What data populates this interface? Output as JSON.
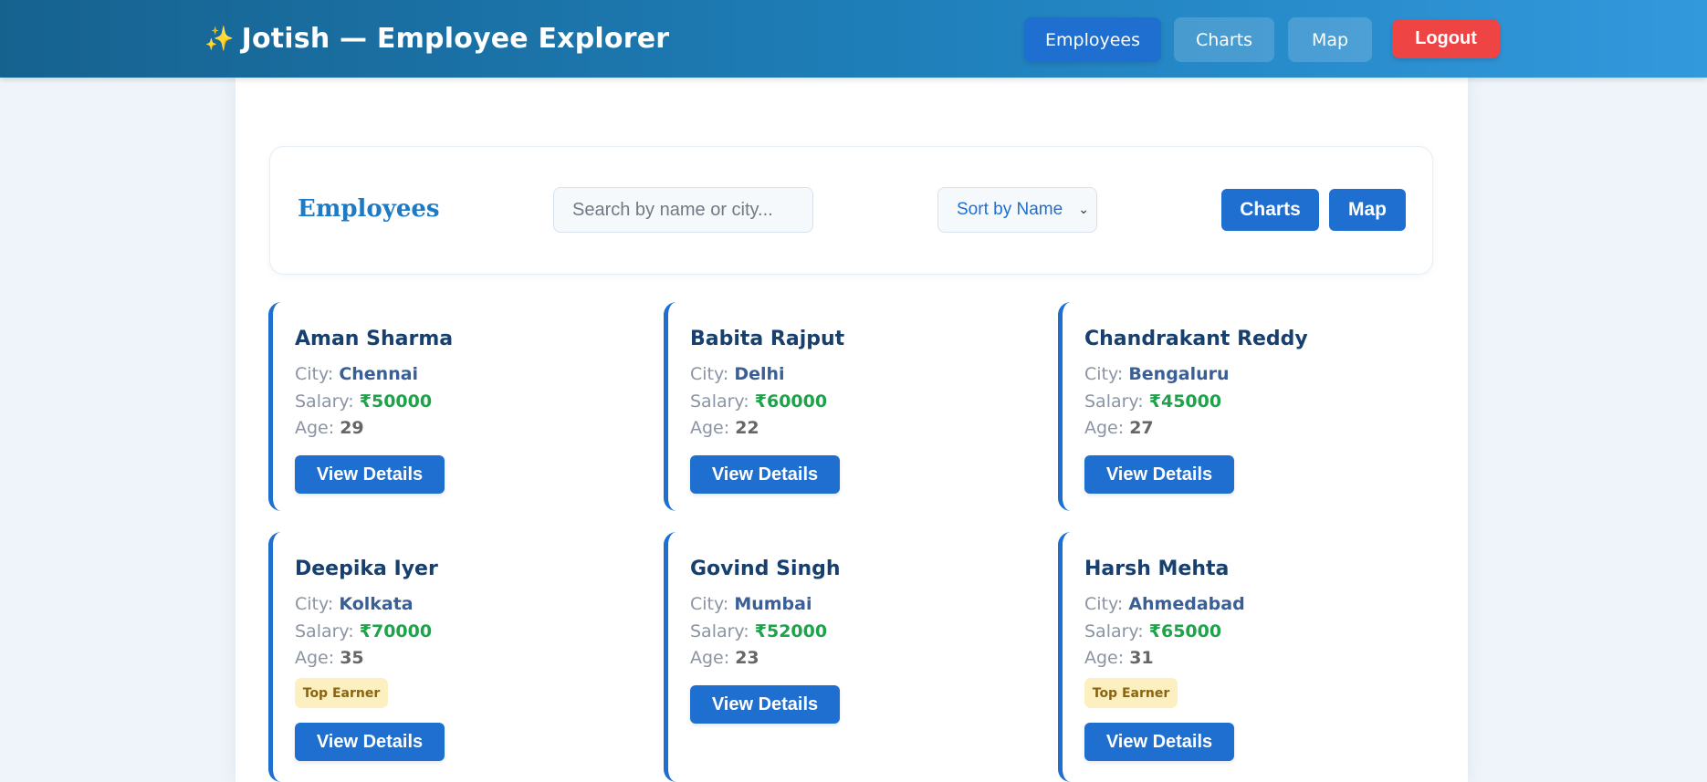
{
  "header": {
    "brand_icon": "sparkles-icon",
    "brand_emoji": "✨",
    "brand_title": "Jotish — Employee Explorer",
    "nav": [
      {
        "label": "Employees",
        "active": true
      },
      {
        "label": "Charts",
        "active": false
      },
      {
        "label": "Map",
        "active": false
      }
    ],
    "logout_label": "Logout"
  },
  "toolbar": {
    "title": "Employees",
    "search_placeholder": "Search by name or city...",
    "sort_selected": "Sort by Name",
    "charts_label": "Charts",
    "map_label": "Map"
  },
  "labels": {
    "city": "City: ",
    "salary": "Salary: ",
    "age": "Age: ",
    "view_details": "View Details",
    "top_earner": "Top Earner"
  },
  "employees": [
    {
      "name": "Aman Sharma",
      "city": "Chennai",
      "salary": "₹50000",
      "age": "29",
      "top_earner": false
    },
    {
      "name": "Babita Rajput",
      "city": "Delhi",
      "salary": "₹60000",
      "age": "22",
      "top_earner": false
    },
    {
      "name": "Chandrakant Reddy",
      "city": "Bengaluru",
      "salary": "₹45000",
      "age": "27",
      "top_earner": false
    },
    {
      "name": "Deepika Iyer",
      "city": "Kolkata",
      "salary": "₹70000",
      "age": "35",
      "top_earner": true
    },
    {
      "name": "Govind Singh",
      "city": "Mumbai",
      "salary": "₹52000",
      "age": "23",
      "top_earner": false
    },
    {
      "name": "Harsh Mehta",
      "city": "Ahmedabad",
      "salary": "₹65000",
      "age": "31",
      "top_earner": true
    }
  ],
  "colors": {
    "accent": "#1e6fd0",
    "logout": "#ef4444",
    "salary": "#1fa34a",
    "badge_bg": "#fdf0c0"
  }
}
